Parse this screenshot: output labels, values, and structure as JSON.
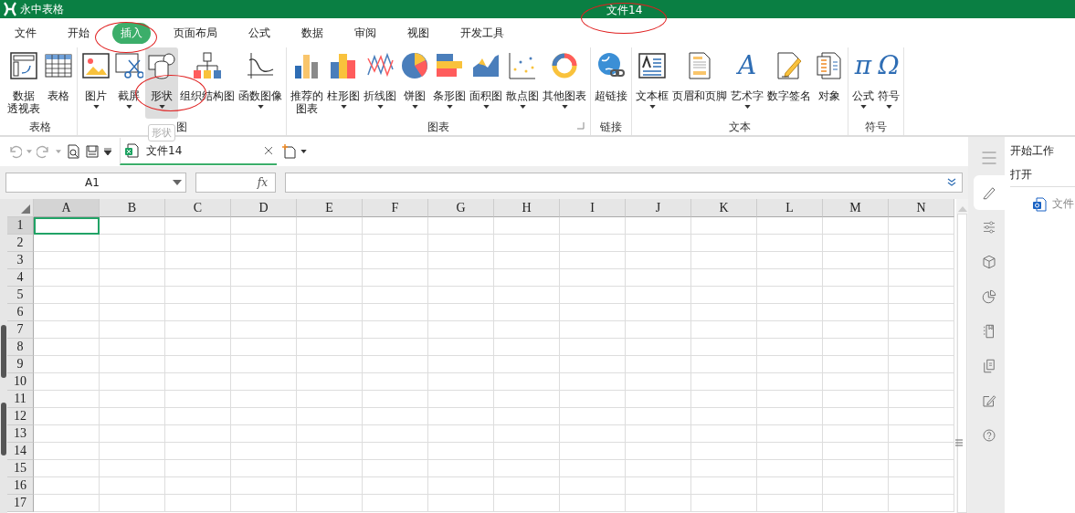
{
  "title_bar": {
    "app_name": "永中表格",
    "document_title": "文件14"
  },
  "menu_tabs": [
    {
      "label": "文件",
      "selected": false
    },
    {
      "label": "开始",
      "selected": false
    },
    {
      "label": "插入",
      "selected": true
    },
    {
      "label": "页面布局",
      "selected": false
    },
    {
      "label": "公式",
      "selected": false
    },
    {
      "label": "数据",
      "selected": false
    },
    {
      "label": "审阅",
      "selected": false
    },
    {
      "label": "视图",
      "selected": false
    },
    {
      "label": "开发工具",
      "selected": false
    }
  ],
  "ribbon_groups": [
    {
      "label": "表格",
      "items": [
        {
          "label_lines": [
            "数据",
            "透视表"
          ],
          "hovered": false
        },
        {
          "label_lines": [
            "表格"
          ],
          "hovered": false
        }
      ]
    },
    {
      "label": "图",
      "items": [
        {
          "label_lines": [
            "图片"
          ],
          "dropdown": true,
          "hovered": false
        },
        {
          "label_lines": [
            "截屏"
          ],
          "dropdown": true,
          "hovered": false
        },
        {
          "label_lines": [
            "形状"
          ],
          "dropdown": true,
          "hovered": true
        },
        {
          "label_lines": [
            "组织结构图"
          ],
          "hovered": false
        },
        {
          "label_lines": [
            "函数图像"
          ],
          "dropdown": true,
          "hovered": false
        }
      ]
    },
    {
      "label": "图表",
      "launcher": true,
      "items": [
        {
          "label_lines": [
            "推荐的",
            "图表"
          ],
          "hovered": false
        },
        {
          "label_lines": [
            "柱形图"
          ],
          "dropdown": true,
          "hovered": false
        },
        {
          "label_lines": [
            "折线图"
          ],
          "dropdown": true,
          "hovered": false
        },
        {
          "label_lines": [
            "饼图"
          ],
          "dropdown": true,
          "hovered": false
        },
        {
          "label_lines": [
            "条形图"
          ],
          "dropdown": true,
          "hovered": false
        },
        {
          "label_lines": [
            "面积图"
          ],
          "dropdown": true,
          "hovered": false
        },
        {
          "label_lines": [
            "散点图"
          ],
          "dropdown": true,
          "hovered": false
        },
        {
          "label_lines": [
            "其他图表"
          ],
          "dropdown": true,
          "hovered": false
        }
      ]
    },
    {
      "label": "链接",
      "items": [
        {
          "label_lines": [
            "超链接"
          ],
          "hovered": false
        }
      ]
    },
    {
      "label": "文本",
      "items": [
        {
          "label_lines": [
            "文本框"
          ],
          "dropdown": true,
          "hovered": false
        },
        {
          "label_lines": [
            "页眉和页脚"
          ],
          "hovered": false
        },
        {
          "label_lines": [
            "艺术字"
          ],
          "dropdown": true,
          "hovered": false,
          "glyph": "A"
        },
        {
          "label_lines": [
            "数字签名"
          ],
          "hovered": false
        },
        {
          "label_lines": [
            "对象"
          ],
          "hovered": false
        }
      ]
    },
    {
      "label": "符号",
      "items": [
        {
          "label_lines": [
            "公式"
          ],
          "dropdown": true,
          "hovered": false,
          "glyph": "π"
        },
        {
          "label_lines": [
            "符号"
          ],
          "dropdown": true,
          "hovered": false,
          "glyph": "Ω"
        }
      ]
    }
  ],
  "tooltip": "形状",
  "document_tabs": [
    {
      "label": "文件14",
      "selected": true
    }
  ],
  "name_box": {
    "value": "A1"
  },
  "fx_label": "fx",
  "columns": [
    {
      "label": "A",
      "selected": true
    },
    {
      "label": "B",
      "selected": false
    },
    {
      "label": "C",
      "selected": false
    },
    {
      "label": "D",
      "selected": false
    },
    {
      "label": "E",
      "selected": false
    },
    {
      "label": "F",
      "selected": false
    },
    {
      "label": "G",
      "selected": false
    },
    {
      "label": "H",
      "selected": false
    },
    {
      "label": "I",
      "selected": false
    },
    {
      "label": "J",
      "selected": false
    },
    {
      "label": "K",
      "selected": false
    },
    {
      "label": "L",
      "selected": false
    },
    {
      "label": "M",
      "selected": false
    },
    {
      "label": "N",
      "selected": false
    }
  ],
  "rows": [
    {
      "label": "1",
      "selected": true
    },
    {
      "label": "2",
      "selected": false
    },
    {
      "label": "3",
      "selected": false
    },
    {
      "label": "4",
      "selected": false
    },
    {
      "label": "5",
      "selected": false
    },
    {
      "label": "6",
      "selected": false
    },
    {
      "label": "7",
      "selected": false
    },
    {
      "label": "8",
      "selected": false
    },
    {
      "label": "9",
      "selected": false
    },
    {
      "label": "10",
      "selected": false
    },
    {
      "label": "11",
      "selected": false
    },
    {
      "label": "12",
      "selected": false
    },
    {
      "label": "13",
      "selected": false
    },
    {
      "label": "14",
      "selected": false
    },
    {
      "label": "15",
      "selected": false
    },
    {
      "label": "16",
      "selected": false
    },
    {
      "label": "17",
      "selected": false
    }
  ],
  "side_panel": {
    "title": "开始工作",
    "section": "打开",
    "files": [
      "文件"
    ],
    "tools": [
      {
        "selected": false
      },
      {
        "selected": true
      },
      {
        "selected": false
      },
      {
        "selected": false
      },
      {
        "selected": false
      },
      {
        "selected": false
      },
      {
        "selected": false
      },
      {
        "selected": false
      },
      {
        "selected": false
      }
    ]
  }
}
